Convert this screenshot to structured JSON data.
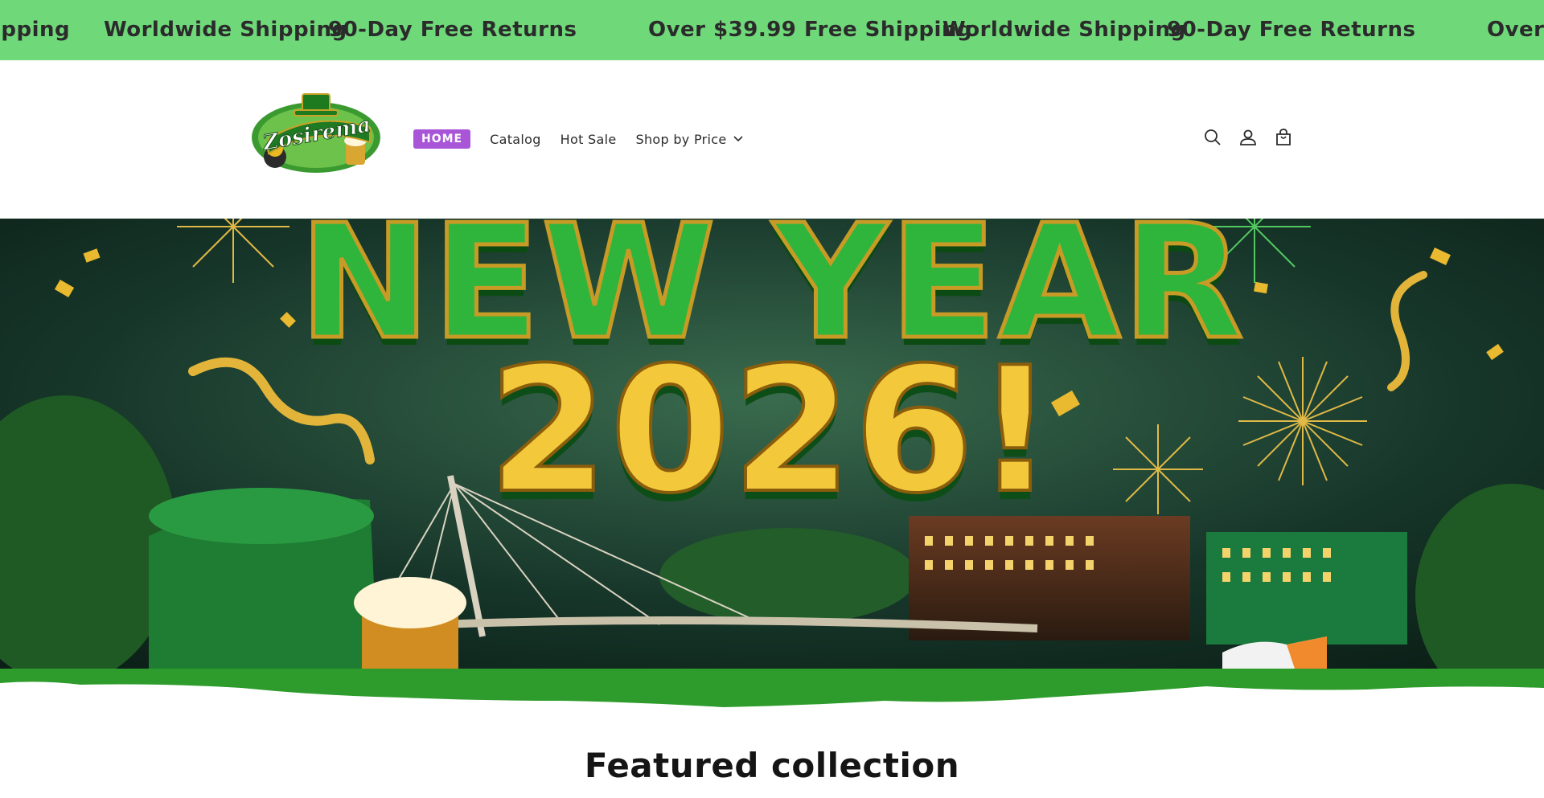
{
  "announcement": {
    "items": [
      "ipping",
      "Worldwide Shipping",
      "90-Day Free Returns",
      "Over $39.99 Free Shipping",
      "Worldwide Shipping",
      "90-Day Free Returns",
      "Over $"
    ]
  },
  "header": {
    "logo_text": "Zosirema",
    "nav": {
      "home": "HOME",
      "catalog": "Catalog",
      "hot_sale": "Hot Sale",
      "shop_by_price": "Shop by Price"
    },
    "icons": [
      "search-icon",
      "account-icon",
      "cart-icon"
    ]
  },
  "hero": {
    "line1": "NEW YEAR",
    "line2": "2026!"
  },
  "featured": {
    "title": "Featured collection"
  },
  "colors": {
    "announcement_bg": "#6fd879",
    "home_badge": "#a855d8",
    "hero_green": "#2e9c2c"
  }
}
